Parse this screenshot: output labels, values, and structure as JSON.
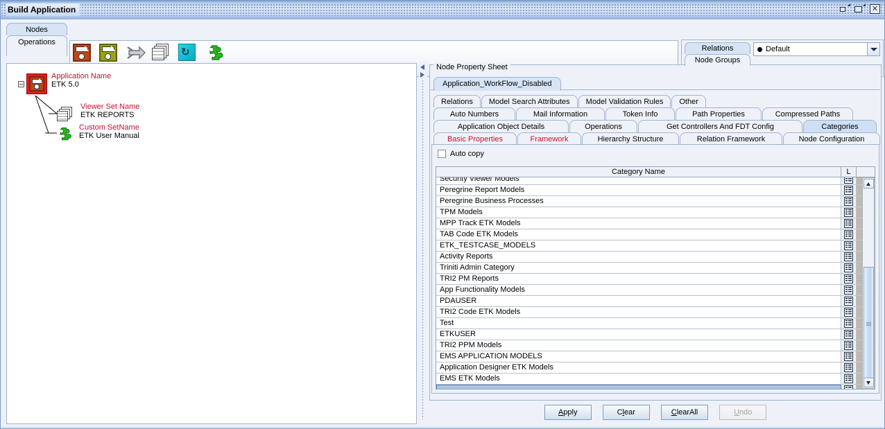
{
  "window": {
    "title": "Build Application",
    "buttons": {
      "restore": "restore-window",
      "maximize": "maximize-window",
      "close": "✕"
    }
  },
  "left_tabs": {
    "items": [
      {
        "label": "Nodes",
        "selected": true
      },
      {
        "label": "Operations",
        "selected": false
      }
    ]
  },
  "toolbar": {
    "icons": [
      {
        "name": "application-node-red-icon",
        "title": "Application Node"
      },
      {
        "name": "application-node-olive-icon",
        "title": "Application Node Alt"
      },
      {
        "name": "arrow-forward-icon",
        "title": "Forward"
      },
      {
        "name": "stacked-documents-icon",
        "title": "Documents"
      },
      {
        "name": "refresh-icon",
        "title": "Refresh"
      },
      {
        "name": "puzzle-piece-icon",
        "title": "Custom Set"
      }
    ]
  },
  "right_top": {
    "tabs": [
      {
        "label": "Relations",
        "selected": true
      },
      {
        "label": "Node Groups",
        "selected": false
      }
    ],
    "combo": {
      "value": "Default",
      "bullet": "●"
    }
  },
  "tree": {
    "nodes": [
      {
        "label": "Application Name",
        "sub": "ETK 5.0",
        "icon": "application-node-red-icon",
        "expander": "collapse-toggle"
      },
      {
        "label": "Viewer Set Name",
        "sub": "ETK REPORTS",
        "icon": "stacked-documents-icon"
      },
      {
        "label": "Custom SetName",
        "sub": "ETK User Manual",
        "icon": "puzzle-piece-icon"
      }
    ]
  },
  "property_sheet": {
    "legend": "Node Property Sheet",
    "sheet_tab": "Application_WorkFlow_Disabled",
    "tab_rows": [
      [
        {
          "label": "Relations",
          "selected": false,
          "red": false
        },
        {
          "label": "Model Search Attributes",
          "selected": false,
          "red": false
        },
        {
          "label": "Model Validation Rules",
          "selected": false,
          "red": false
        },
        {
          "label": "Other",
          "selected": false,
          "red": false
        }
      ],
      [
        {
          "label": "Auto Numbers",
          "selected": false,
          "red": false
        },
        {
          "label": "Mail Information",
          "selected": false,
          "red": false
        },
        {
          "label": "Token Info",
          "selected": false,
          "red": false
        },
        {
          "label": "Path Properties",
          "selected": false,
          "red": false
        },
        {
          "label": "Compressed Paths",
          "selected": false,
          "red": false
        }
      ],
      [
        {
          "label": "Application Object Details",
          "selected": false,
          "red": false
        },
        {
          "label": "Operations",
          "selected": false,
          "red": false
        },
        {
          "label": "Get Controllers And FDT Config",
          "selected": false,
          "red": false
        },
        {
          "label": "Categories",
          "selected": true,
          "red": false
        }
      ],
      [
        {
          "label": "Basic Properties",
          "selected": false,
          "red": true
        },
        {
          "label": "Framework",
          "selected": false,
          "red": true
        },
        {
          "label": "Hierarchy Structure",
          "selected": false,
          "red": false
        },
        {
          "label": "Relation Framework",
          "selected": false,
          "red": false
        },
        {
          "label": "Node Configuration",
          "selected": false,
          "red": false
        }
      ]
    ],
    "auto_copy": {
      "label": "Auto copy",
      "checked": false
    },
    "table": {
      "columns": [
        "Category Name",
        "L"
      ],
      "rows": [
        {
          "name": "Security Viewer Models",
          "selected": false
        },
        {
          "name": "Peregrine Report Models",
          "selected": false
        },
        {
          "name": "Peregrine Business Processes",
          "selected": false
        },
        {
          "name": "TPM Models",
          "selected": false
        },
        {
          "name": "MPP Track ETK Models",
          "selected": false
        },
        {
          "name": "TAB Code ETK Models",
          "selected": false
        },
        {
          "name": "ETK_TESTCASE_MODELS",
          "selected": false
        },
        {
          "name": "Activity Reports",
          "selected": false
        },
        {
          "name": "Triniti Admin Category",
          "selected": false
        },
        {
          "name": "TRI2 PM Reports",
          "selected": false
        },
        {
          "name": "App Functionality Models",
          "selected": false
        },
        {
          "name": "PDAUSER",
          "selected": false
        },
        {
          "name": "TRI2 Code ETK Models",
          "selected": false
        },
        {
          "name": "Test",
          "selected": false
        },
        {
          "name": "ETKUSER",
          "selected": false
        },
        {
          "name": "TRI2 PPM Models",
          "selected": false
        },
        {
          "name": "EMS APPLICATION MODELS",
          "selected": false
        },
        {
          "name": "Application Designer ETK Models",
          "selected": false
        },
        {
          "name": "EMS ETK Models",
          "selected": false
        },
        {
          "name": "",
          "selected": true
        }
      ]
    },
    "buttons": [
      {
        "label": "Apply",
        "mnemonic": "A",
        "disabled": false
      },
      {
        "label": "Clear",
        "mnemonic": "l",
        "disabled": false
      },
      {
        "label": "ClearAll",
        "mnemonic": "C",
        "disabled": false
      },
      {
        "label": "Undo",
        "mnemonic": "U",
        "disabled": true
      }
    ]
  },
  "colors": {
    "accent": "#c8102e",
    "tab_selected": "#cfe0f5",
    "panel_bg": "#eef2f8",
    "border": "#9fb4d0",
    "row_selected": "#aec4e0"
  }
}
